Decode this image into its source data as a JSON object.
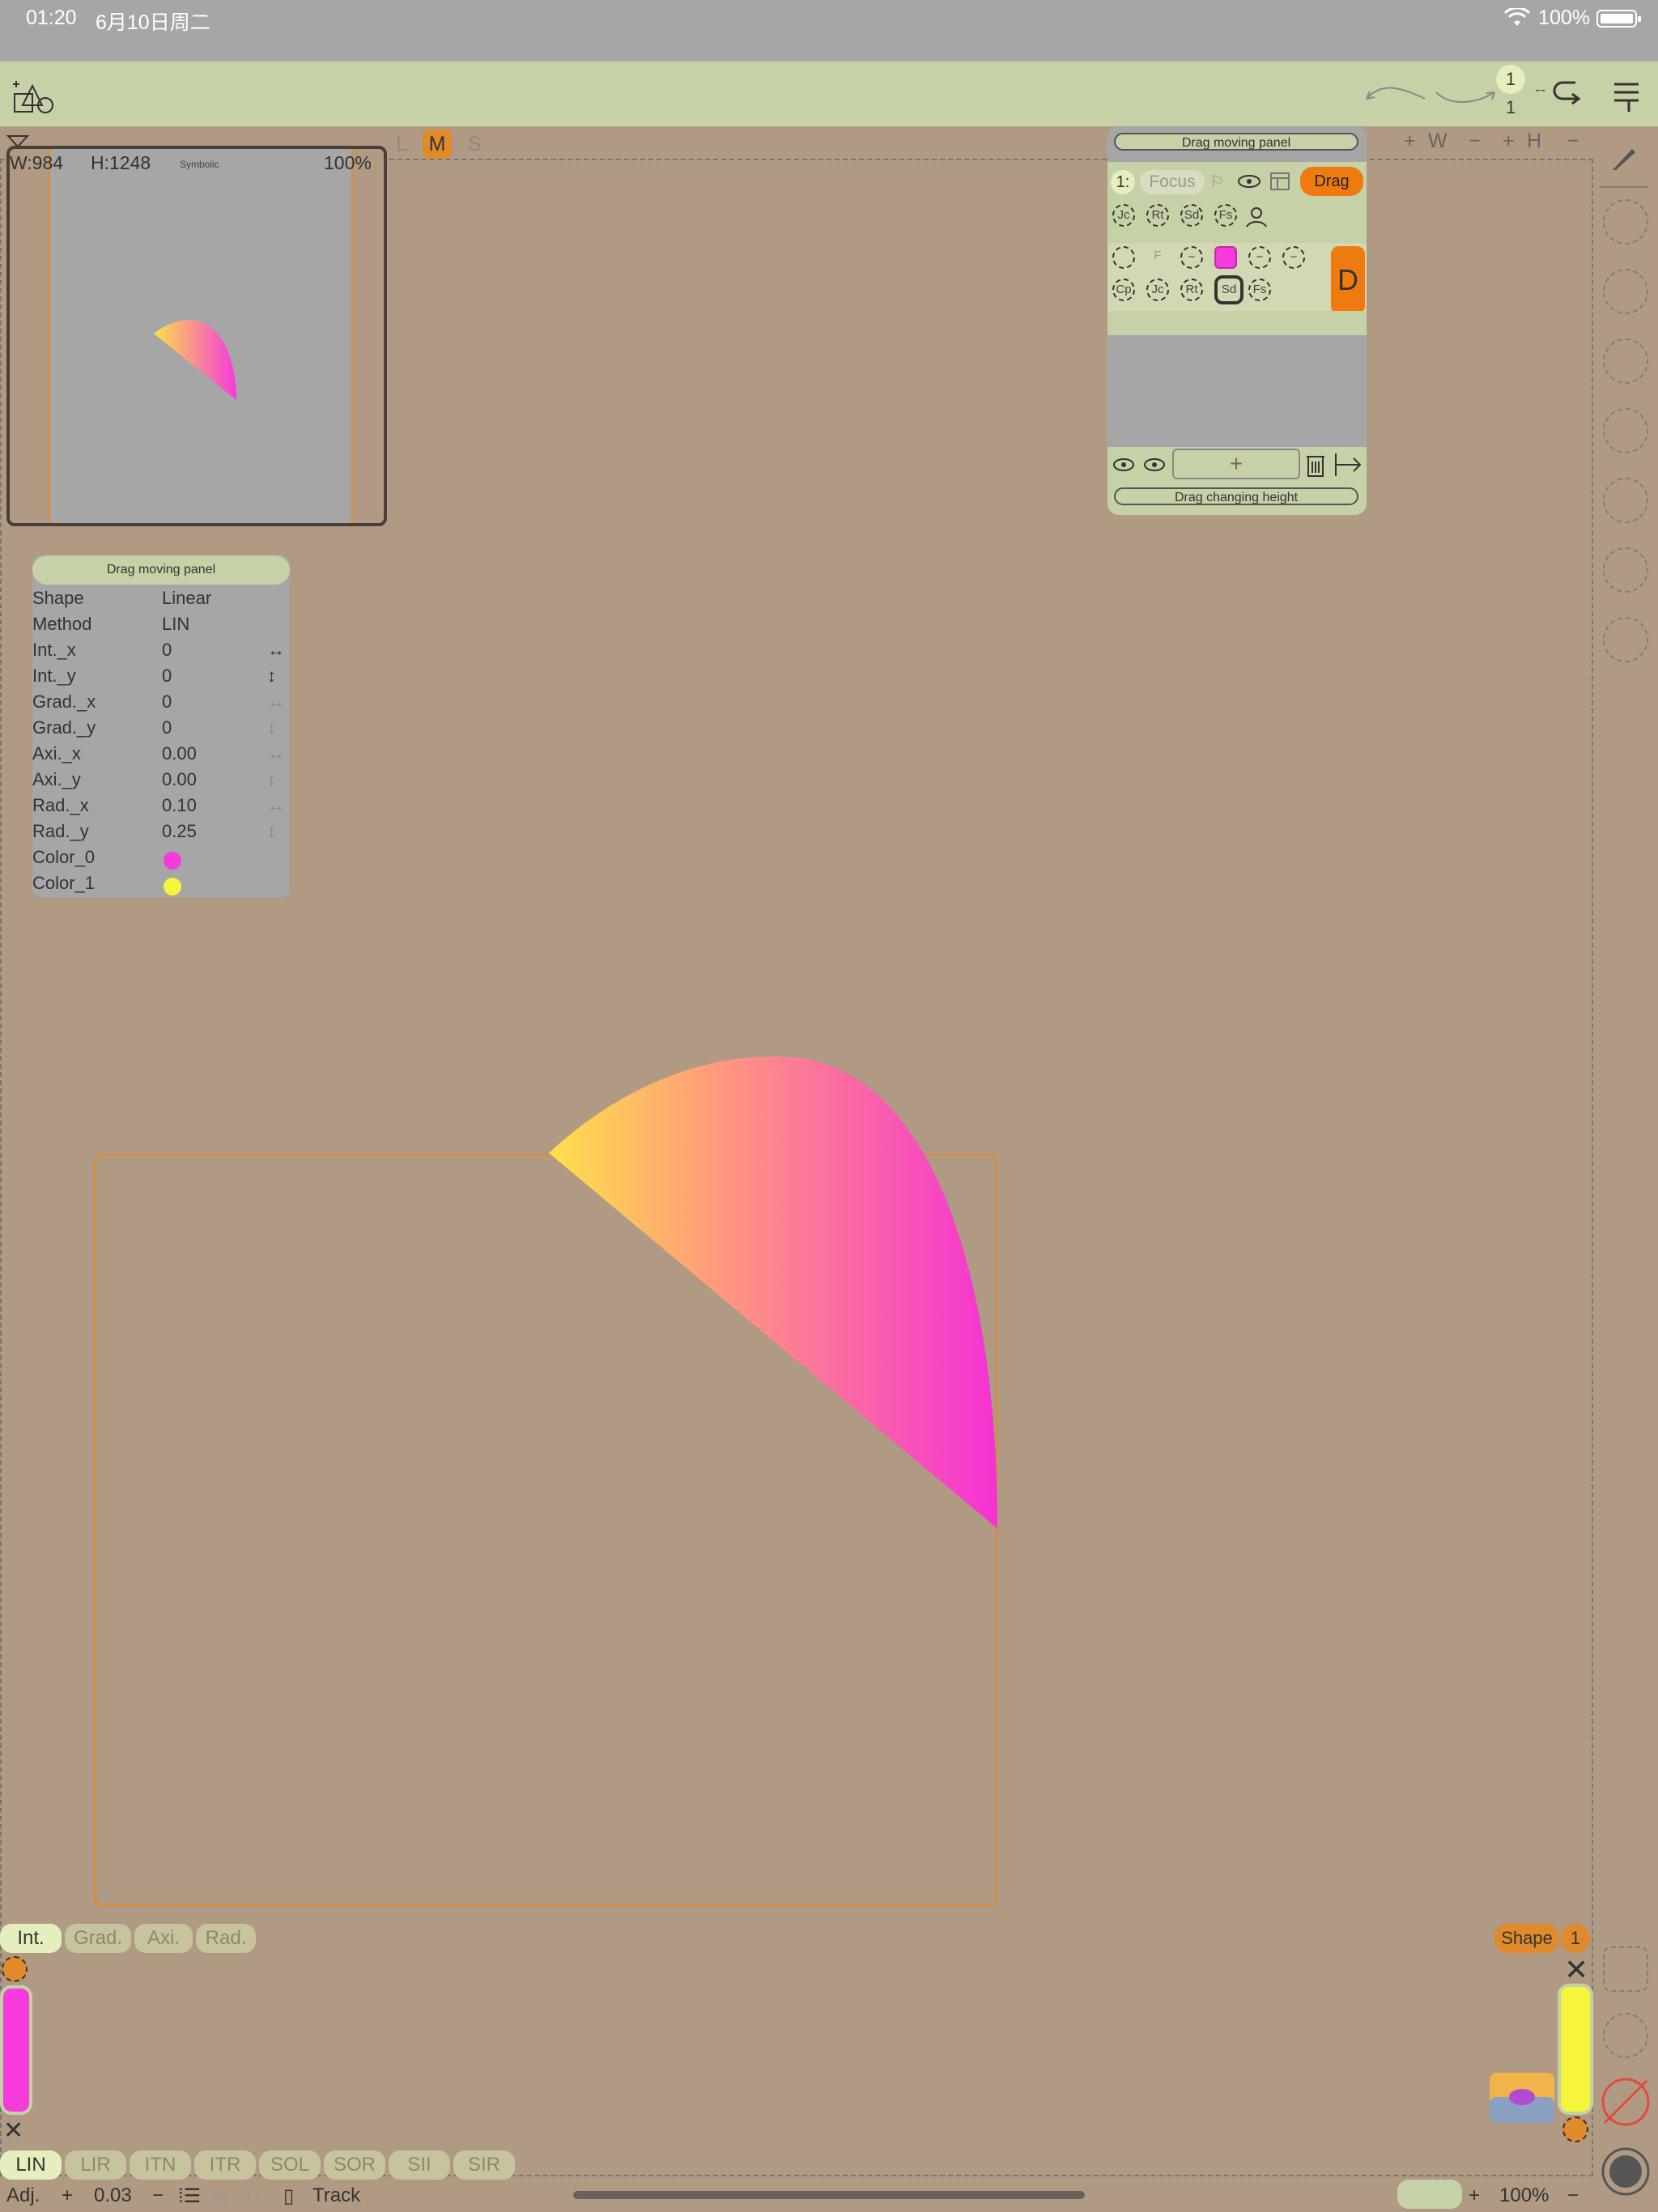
{
  "status": {
    "time": "01:20",
    "date": "6月10日周二",
    "battery": "100%"
  },
  "toolbar": {
    "page_current": "1",
    "page_total": "1"
  },
  "view_modes": [
    "L",
    "M",
    "S"
  ],
  "size_controls": {
    "w_plus": "+",
    "w_label": "W",
    "w_minus": "−",
    "h_plus": "+",
    "h_label": "H",
    "h_minus": "−"
  },
  "minimap": {
    "width": "W:984",
    "height": "H:1248",
    "mode": "Symbolic",
    "zoom": "100%"
  },
  "prop_panel": {
    "drag_label": "Drag moving panel",
    "rows": [
      {
        "key": "Shape",
        "value": "Linear"
      },
      {
        "key": "Method",
        "value": "LIN"
      },
      {
        "key": "Int._x",
        "value": "0"
      },
      {
        "key": "Int._y",
        "value": "0"
      },
      {
        "key": "Grad._x",
        "value": "0"
      },
      {
        "key": "Grad._y",
        "value": "0"
      },
      {
        "key": "Axi._x",
        "value": "0.00"
      },
      {
        "key": "Axi._y",
        "value": "0.00"
      },
      {
        "key": "Rad._x",
        "value": "0.10"
      },
      {
        "key": "Rad._y",
        "value": "0.25"
      },
      {
        "key": "Color_0",
        "value": ""
      },
      {
        "key": "Color_1",
        "value": ""
      }
    ],
    "colors": {
      "color_0": "#f53bdc",
      "color_1": "#f6f53c"
    }
  },
  "layers_panel": {
    "drag_label": "Drag moving panel",
    "height_label": "Drag changing height",
    "layer_index": "1:",
    "focus_label": "Focus",
    "drag_button": "Drag",
    "d_button": "D",
    "chips_row1": [
      "Jc",
      "Rt",
      "Sd",
      "Fs"
    ],
    "chips_row2": [
      "",
      "F",
      "−",
      "",
      "−",
      "−"
    ],
    "chips_row3": [
      "Cp",
      "Jc",
      "Rt",
      "Sd",
      "Fs"
    ],
    "add_label": "+"
  },
  "bottom": {
    "tabs": [
      "Int.",
      "Grad.",
      "Axi.",
      "Rad."
    ],
    "shape_button": "Shape",
    "shape_count": "1",
    "methods": [
      "LIN",
      "LIR",
      "ITN",
      "ITR",
      "SOL",
      "SOR",
      "SII",
      "SIR"
    ],
    "adj_label": "Adj.",
    "adj_plus": "+",
    "adj_value": "0.03",
    "adj_minus": "−",
    "track_label": "Track",
    "zoom_plus": "+",
    "zoom": "100%",
    "zoom_minus": "−"
  },
  "colors": {
    "accent": "#ef7b10",
    "toolbar_bg": "#c6d1a8",
    "canvas_bg": "#b09a83",
    "panel_bg": "#a6a6a6"
  }
}
